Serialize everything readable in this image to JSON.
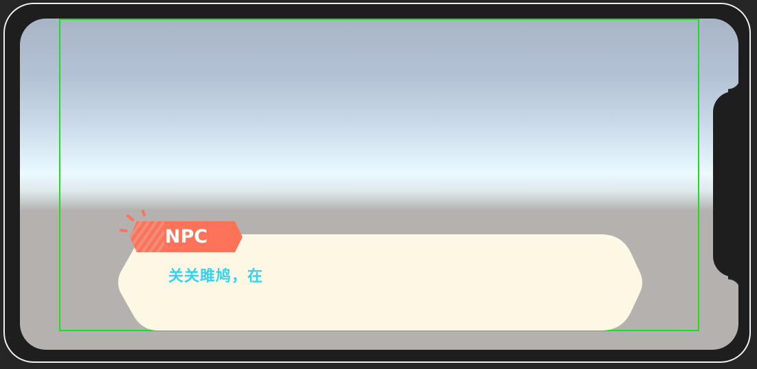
{
  "npc_name": "NPC",
  "dialog_text": "关关雎鸠，在",
  "colors": {
    "dialog_bg": "#fdf8e4",
    "name_tag": "#fd735a",
    "dialog_text": "#36d2ee",
    "safe_area": "#1fdc1f"
  },
  "icons": {
    "name_tag_sparkle": "sparkle-lines-icon"
  }
}
